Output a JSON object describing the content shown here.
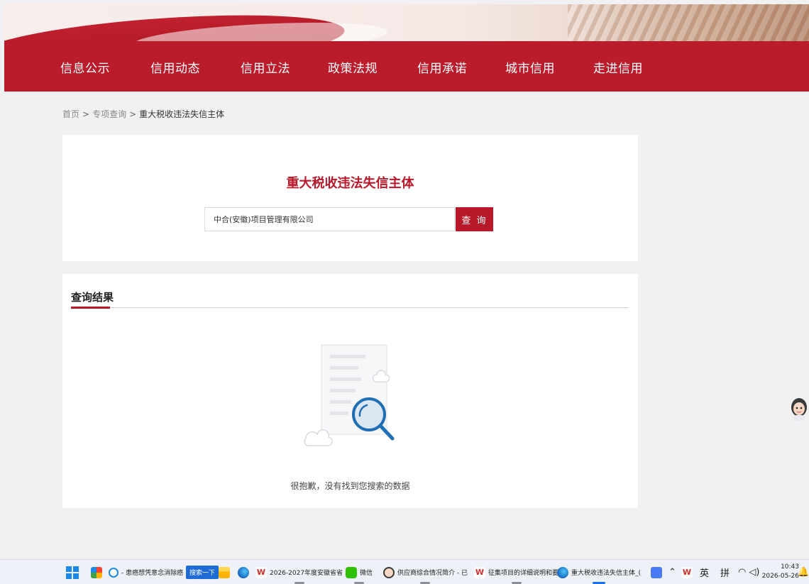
{
  "nav": {
    "items": [
      "信息公示",
      "信用动态",
      "信用立法",
      "政策法规",
      "信用承诺",
      "城市信用",
      "走进信用"
    ]
  },
  "breadcrumb": {
    "home": "首页",
    "separator": ">",
    "section": "专项查询",
    "current": "重大税收违法失信主体"
  },
  "search": {
    "title": "重大税收违法失信主体",
    "value": "中合(安徽)项目管理有限公司",
    "button_label": "查 询"
  },
  "results": {
    "heading": "查询结果",
    "empty_message": "很抱歉，没有找到您搜索的数据"
  },
  "taskbar": {
    "items": [
      {
        "icon": "windows-start-icon"
      },
      {
        "icon": "app-icon"
      },
      {
        "icon": "ie-browser-icon",
        "label": "- 患癌想凭意念消除癌"
      },
      {
        "label": "搜索一下"
      },
      {
        "icon": "file-explorer-icon"
      },
      {
        "icon": "edge-browser-icon"
      },
      {
        "icon": "wps-icon",
        "label": "2026-2027年度安徽省省"
      },
      {
        "icon": "wechat-icon",
        "label": "微信"
      },
      {
        "icon": "avatar-icon",
        "label": "供应商综合情况简介 - 已"
      },
      {
        "icon": "wps-icon",
        "label": "征集项目的详细说明和要"
      },
      {
        "icon": "edge-browser-icon",
        "label": "重大税收违法失信主体_("
      }
    ],
    "tray": {
      "ime_lang": "英",
      "ime_mode": "拼",
      "time": "10:43",
      "date": "2026-05-26"
    }
  },
  "colors": {
    "brand_red": "#bb1c2c",
    "title_red": "#b8182a",
    "illustration_blue": "#1f6fb5"
  }
}
